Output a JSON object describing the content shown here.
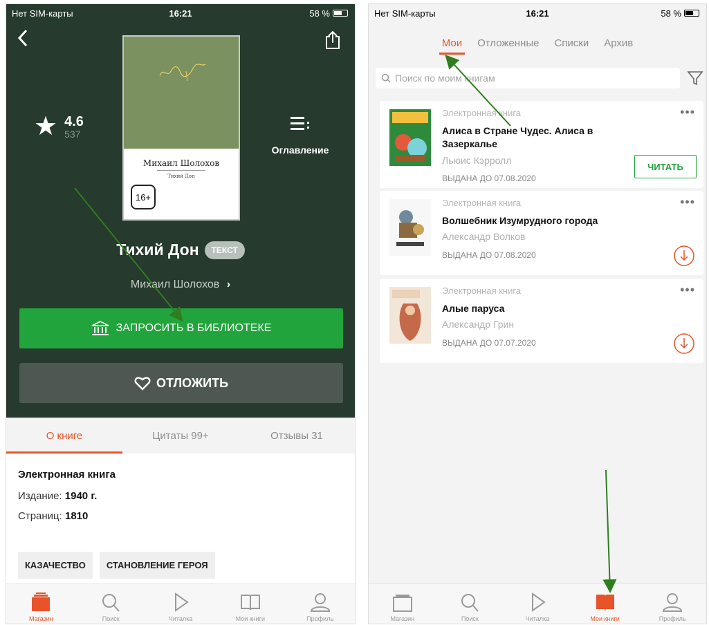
{
  "left": {
    "status": {
      "carrier": "Нет SIM-карты",
      "time": "16:21",
      "battery": "58 %"
    },
    "cover": {
      "author": "Михаил Шолохов",
      "subtitle": "Тихий Дон",
      "age": "16+"
    },
    "rating": {
      "value": "4.6",
      "count": "537"
    },
    "toc_label": "Оглавление",
    "book_title": "Тихий Дон",
    "format_badge": "ТЕКСТ",
    "author": "Михаил Шолохов",
    "request_label": "ЗАПРОСИТЬ В БИБЛИОТЕКЕ",
    "defer_label": "ОТЛОЖИТЬ",
    "tabs": [
      {
        "label": "О книге"
      },
      {
        "label": "Цитаты 99+"
      },
      {
        "label": "Отзывы 31"
      }
    ],
    "info": {
      "kind": "Электронная книга",
      "edition_label": "Издание:",
      "edition_value": "1940 г.",
      "pages_label": "Страниц:",
      "pages_value": "1810"
    },
    "tags": [
      "КАЗАЧЕСТВО",
      "СТАНОВЛЕНИЕ ГЕРОЯ"
    ],
    "nav": [
      {
        "label": "Магазин",
        "icon": "store-icon",
        "active": true
      },
      {
        "label": "Поиск",
        "icon": "search-icon"
      },
      {
        "label": "Читалка",
        "icon": "play-icon"
      },
      {
        "label": "Мои книги",
        "icon": "book-icon"
      },
      {
        "label": "Профиль",
        "icon": "profile-icon"
      }
    ]
  },
  "right": {
    "status": {
      "carrier": "Нет SIM-карты",
      "time": "16:21",
      "battery": "58 %"
    },
    "tabs": [
      {
        "label": "Мои",
        "active": true
      },
      {
        "label": "Отложенные"
      },
      {
        "label": "Списки"
      },
      {
        "label": "Архив"
      }
    ],
    "search_placeholder": "Поиск по моим книгам",
    "books": [
      {
        "type": "Электронная книга",
        "title": "Алиса в Стране Чудес. Алиса в Зазеркалье",
        "author": "Льюис Кэрролл",
        "due": "ВЫДАНА ДО 07.08.2020",
        "action": "ЧИТАТЬ"
      },
      {
        "type": "Электронная книга",
        "title": "Волшебник Изумрудного города",
        "author": "Александр Волков",
        "due": "ВЫДАНА ДО 07.08.2020"
      },
      {
        "type": "Электронная книга",
        "title": "Алые паруса",
        "author": "Александр Грин",
        "due": "ВЫДАНА ДО 07.07.2020"
      }
    ],
    "nav": [
      {
        "label": "Магазин",
        "icon": "store-icon"
      },
      {
        "label": "Поиск",
        "icon": "search-icon"
      },
      {
        "label": "Читалка",
        "icon": "play-icon"
      },
      {
        "label": "Мои книги",
        "icon": "book-icon",
        "active": true
      },
      {
        "label": "Профиль",
        "icon": "profile-icon"
      }
    ]
  },
  "colors": {
    "accent": "#e8532a",
    "green": "#21a43c",
    "dark": "#263a2e"
  }
}
